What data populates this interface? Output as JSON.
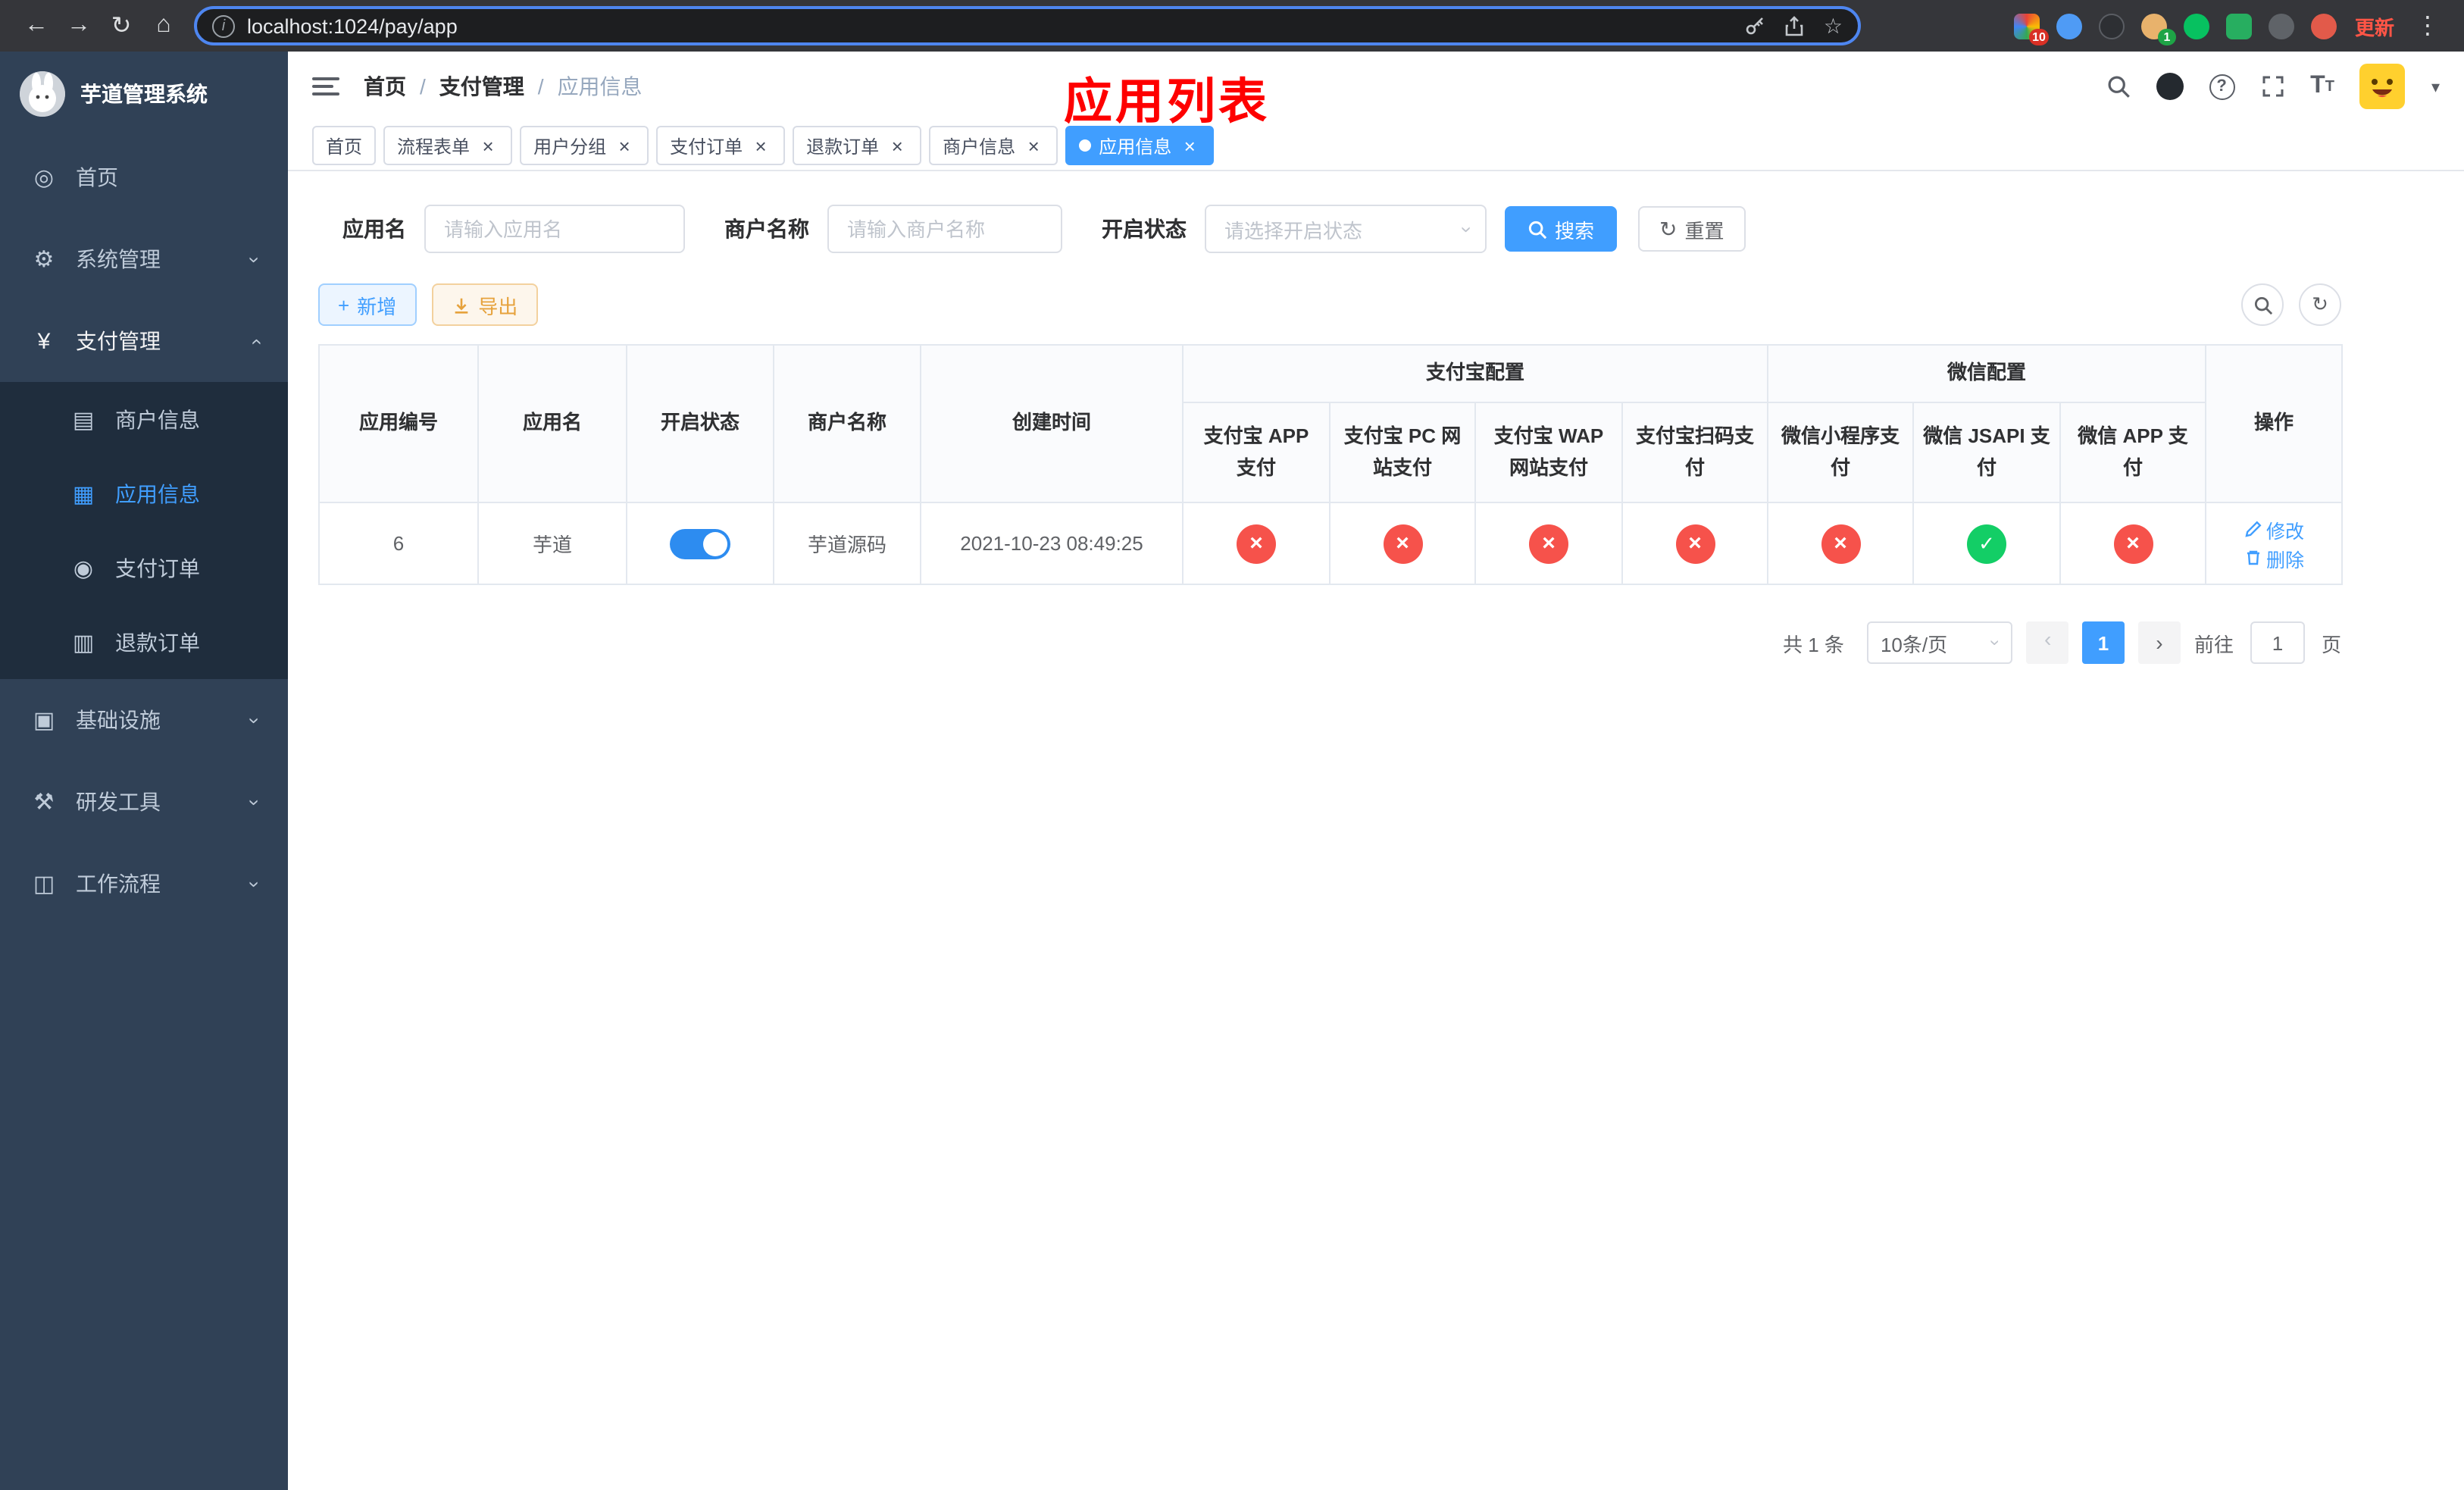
{
  "browser": {
    "url": "localhost:1024/pay/app",
    "update_label": "更新",
    "ext_badge_red": "10",
    "ext_badge_green": "1"
  },
  "icons": {
    "back": "←",
    "forward": "→",
    "reload": "↻",
    "home": "⌂",
    "info": "i",
    "star": "☆",
    "dots": "⋮",
    "dashboard": "◎",
    "gear": "⚙",
    "yen": "¥",
    "merchant": "▤",
    "app_grid": "▦",
    "order": "◉",
    "refund": "▥",
    "infra": "▣",
    "tools": "⚒",
    "workflow": "◫",
    "chevron": "›",
    "close": "×",
    "caret": "▾",
    "plus": "+",
    "question": "?",
    "letter_t": "T"
  },
  "sidebar": {
    "logo_title": "芋道管理系统",
    "items": [
      {
        "label": "首页"
      },
      {
        "label": "系统管理"
      },
      {
        "label": "支付管理"
      },
      {
        "label": "基础设施"
      },
      {
        "label": "研发工具"
      },
      {
        "label": "工作流程"
      }
    ],
    "submenu": [
      {
        "label": "商户信息"
      },
      {
        "label": "应用信息"
      },
      {
        "label": "支付订单"
      },
      {
        "label": "退款订单"
      }
    ]
  },
  "header": {
    "breadcrumb": [
      "首页",
      "支付管理",
      "应用信息"
    ],
    "annotation": "应用列表"
  },
  "tabs": [
    {
      "label": "首页"
    },
    {
      "label": "流程表单"
    },
    {
      "label": "用户分组"
    },
    {
      "label": "支付订单"
    },
    {
      "label": "退款订单"
    },
    {
      "label": "商户信息"
    },
    {
      "label": "应用信息"
    }
  ],
  "filter": {
    "app_name_label": "应用名",
    "app_name_placeholder": "请输入应用名",
    "merchant_label": "商户名称",
    "merchant_placeholder": "请输入商户名称",
    "status_label": "开启状态",
    "status_placeholder": "请选择开启状态",
    "search_label": "搜索",
    "reset_label": "重置"
  },
  "toolbar": {
    "add_label": "新增",
    "export_label": "导出"
  },
  "table": {
    "headers": {
      "app_id": "应用编号",
      "app_name": "应用名",
      "status": "开启状态",
      "merchant": "商户名称",
      "created": "创建时间",
      "alipay_group": "支付宝配置",
      "wechat_group": "微信配置",
      "alipay_app": "支付宝 APP 支付",
      "alipay_pc": "支付宝 PC 网站支付",
      "alipay_wap": "支付宝 WAP 网站支付",
      "alipay_qr": "支付宝扫码支付",
      "wx_mini": "微信小程序支付",
      "wx_jsapi": "微信 JSAPI 支付",
      "wx_app": "微信 APP 支付",
      "actions": "操作"
    },
    "rows": [
      {
        "app_id": "6",
        "app_name": "芋道",
        "enabled": "on",
        "merchant": "芋道源码",
        "created": "2021-10-23 08:49:25",
        "statuses": [
          "cross",
          "cross",
          "cross",
          "cross",
          "cross",
          "check",
          "cross"
        ],
        "edit_label": "修改",
        "delete_label": "删除"
      }
    ]
  },
  "pagination": {
    "total": "共 1 条",
    "page_size": "10条/页",
    "page": "1",
    "goto_label": "前往",
    "goto_value": "1",
    "page_unit": "页"
  },
  "colors": {
    "accent": "#409eff",
    "danger": "#f6524b",
    "success": "#13ce66",
    "warning": "#e6a23c",
    "sidebar_bg": "#304156",
    "annotation": "#fe0000"
  }
}
